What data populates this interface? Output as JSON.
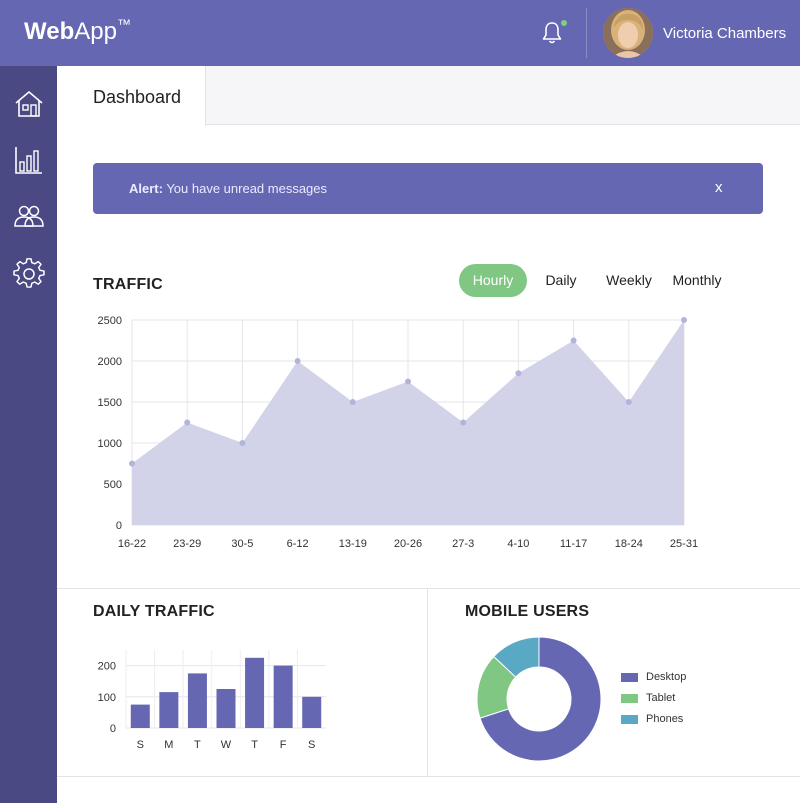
{
  "header": {
    "logo_bold": "Web",
    "logo_light": "App",
    "logo_tm": "™",
    "user_name": "Victoria Chambers",
    "notification_indicator_color": "#7ed17a"
  },
  "sidebar": {
    "items": [
      {
        "icon": "home-icon"
      },
      {
        "icon": "bar-chart-icon"
      },
      {
        "icon": "users-icon"
      },
      {
        "icon": "gear-icon"
      }
    ]
  },
  "tabs": {
    "active": "Dashboard"
  },
  "alert": {
    "label": "Alert:",
    "message": " You have unread messages",
    "close": "x"
  },
  "traffic": {
    "title": "TRAFFIC",
    "ranges": [
      "Hourly",
      "Daily",
      "Weekly",
      "Monthly"
    ],
    "active_range": "Hourly"
  },
  "daily_traffic": {
    "title": "DAILY TRAFFIC"
  },
  "mobile_users": {
    "title": "MOBILE USERS",
    "legend": [
      {
        "label": "Desktop",
        "color": "#6567b2"
      },
      {
        "label": "Tablet",
        "color": "#81c784"
      },
      {
        "label": "Phones",
        "color": "#5aa9c4"
      }
    ]
  },
  "colors": {
    "brand": "#6567b2",
    "sidebar": "#4a4983",
    "accent_green": "#81c784",
    "area_fill": "#d0d1e8"
  },
  "chart_data": [
    {
      "type": "area",
      "categories": [
        "16-22",
        "23-29",
        "30-5",
        "6-12",
        "13-19",
        "20-26",
        "27-3",
        "4-10",
        "11-17",
        "18-24",
        "25-31"
      ],
      "values": [
        750,
        1250,
        1000,
        2000,
        1500,
        1750,
        1250,
        1850,
        2250,
        1500,
        2500
      ],
      "ylim": [
        0,
        2500
      ],
      "yticks": [
        0,
        500,
        1000,
        1500,
        2000,
        2500
      ],
      "grid": true
    },
    {
      "type": "bar",
      "categories": [
        "S",
        "M",
        "T",
        "W",
        "T",
        "F",
        "S"
      ],
      "values": [
        75,
        115,
        175,
        125,
        225,
        200,
        100
      ],
      "ylim": [
        0,
        250
      ],
      "yticks": [
        0,
        100,
        200
      ],
      "grid": true
    },
    {
      "type": "pie",
      "donut": true,
      "labels": [
        "Desktop",
        "Tablet",
        "Phones"
      ],
      "values": [
        70,
        17,
        13
      ]
    }
  ]
}
